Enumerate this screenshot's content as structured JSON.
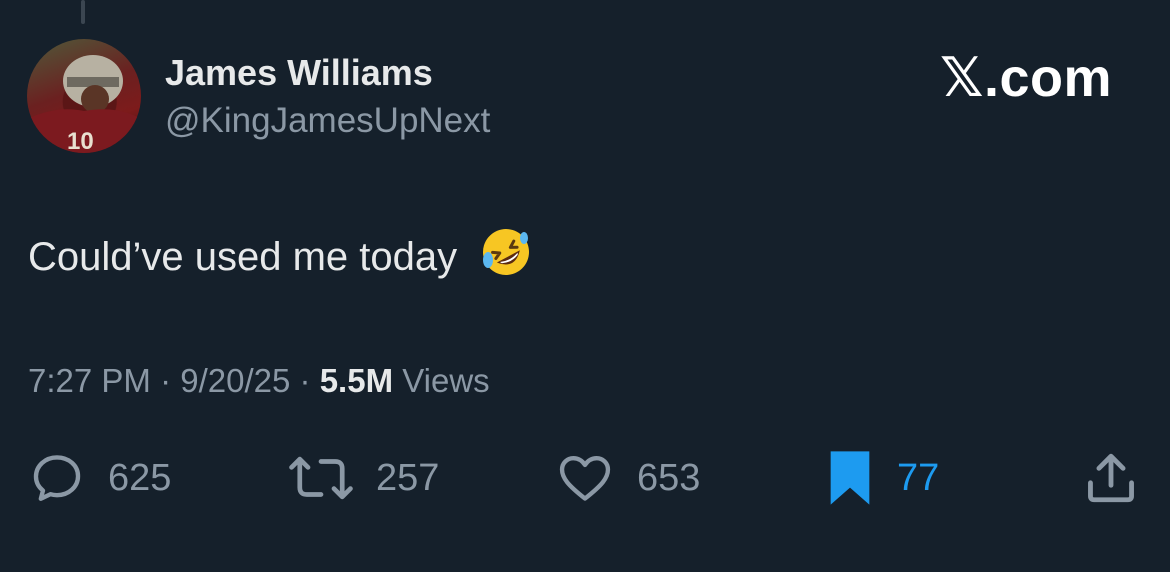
{
  "tweet": {
    "author": {
      "display_name": "James Williams",
      "handle": "@KingJamesUpNext"
    },
    "brand": "𝕏.com",
    "text": "Could’ve used me today",
    "emoji": "rolling-on-the-floor-laughing-emoji",
    "meta": {
      "time": "7:27 PM",
      "separator": "·",
      "date": "9/20/25",
      "views_count": "5.5M",
      "views_label": "Views"
    },
    "actions": {
      "replies": "625",
      "reposts": "257",
      "likes": "653",
      "bookmarks": "77",
      "bookmarked": true
    }
  },
  "colors": {
    "background": "#15202b",
    "text_primary": "#e7e9ea",
    "text_secondary": "#8b98a5",
    "accent": "#1d9bf0"
  },
  "icons": {
    "reply": "reply-bubble-icon",
    "repost": "repost-icon",
    "like": "heart-icon",
    "bookmark": "bookmark-filled-icon",
    "share": "share-icon"
  }
}
